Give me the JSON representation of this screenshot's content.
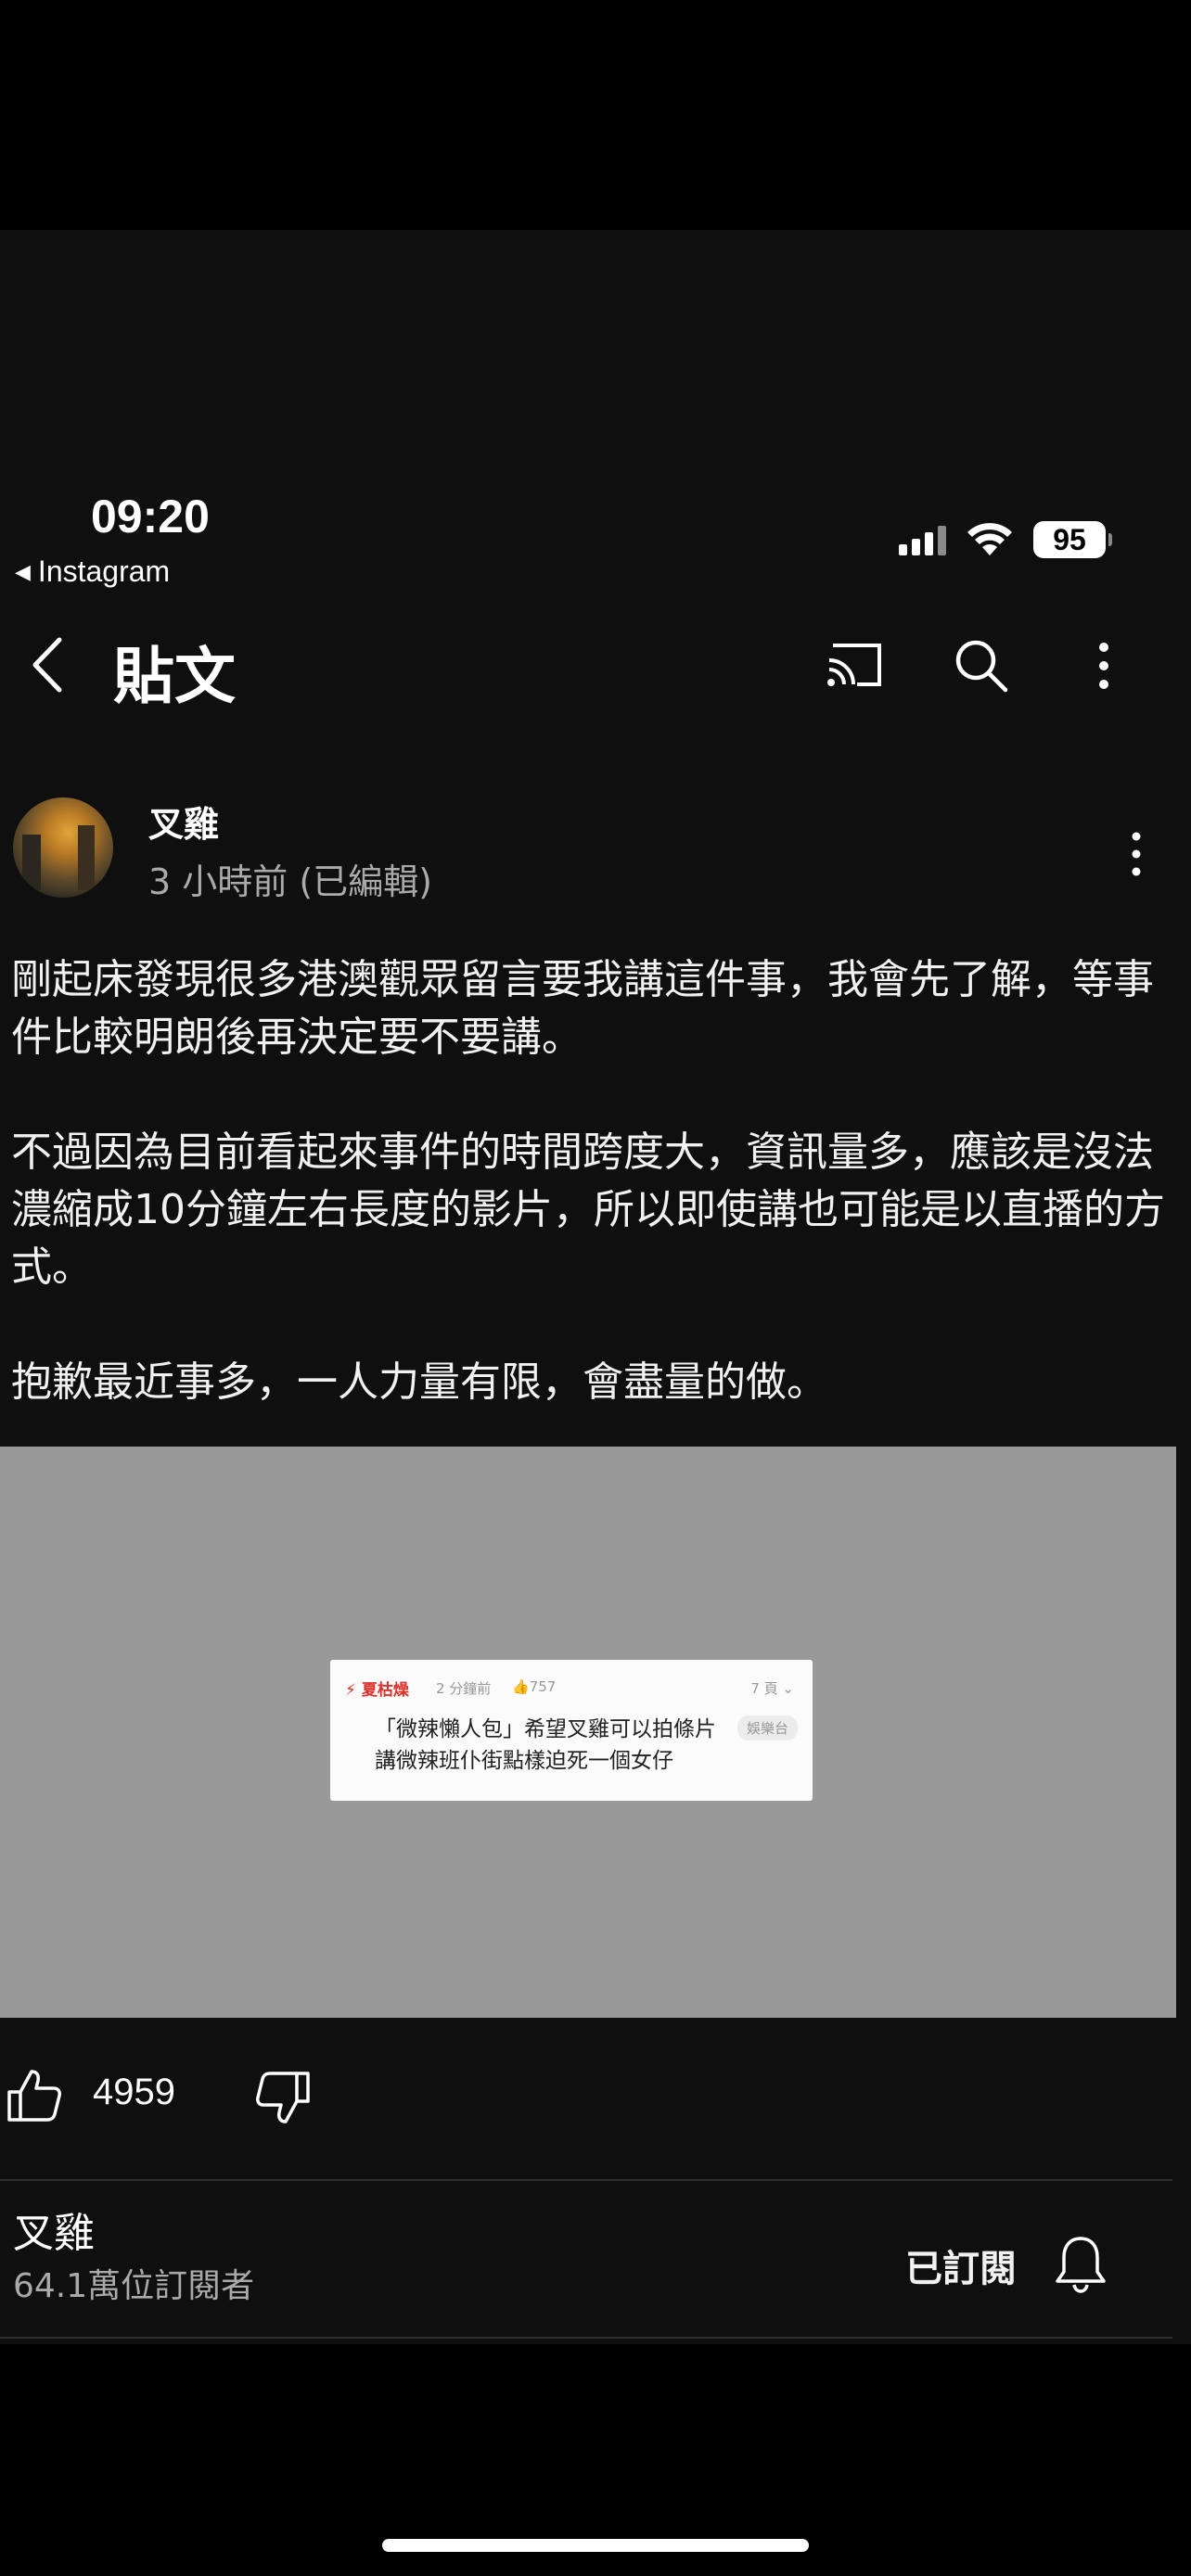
{
  "status_bar": {
    "time": "09:20",
    "back_app": "Instagram",
    "battery": "95"
  },
  "header": {
    "title": "貼文"
  },
  "post": {
    "author": "叉雞",
    "time": "3 小時前 (已編輯)",
    "paragraphs": [
      "剛起床發現很多港澳觀眾留言要我講這件事，我會先了解，等事件比較明朗後再決定要不要講。",
      "不過因為目前看起來事件的時間跨度大，資訊量多，應該是沒法濃縮成10分鐘左右長度的影片，所以即使講也可能是以直播的方式。",
      "抱歉最近事多，一人力量有限，會盡量的做。"
    ],
    "image_card": {
      "user": "⚡ 夏枯燥",
      "time": "2 分鐘前",
      "likes": "👍757",
      "pages": "7 頁 ⌄",
      "title": "「微辣懶人包」希望叉雞可以拍條片講微辣班仆街點樣迫死一個女仔",
      "tag": "娛樂台"
    },
    "like_count": "4959"
  },
  "channel": {
    "name": "叉雞",
    "subscribers": "64.1萬位訂閱者",
    "subscribed_label": "已訂閱"
  }
}
